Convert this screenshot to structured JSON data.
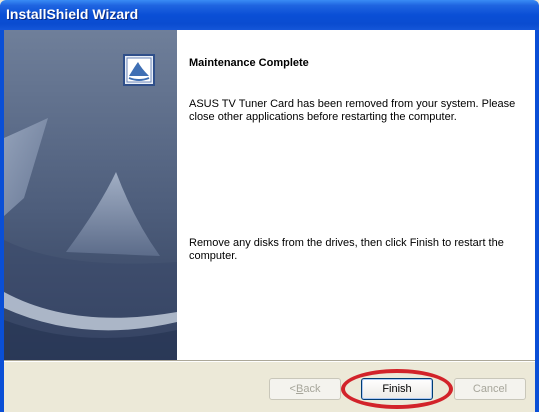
{
  "window": {
    "title": "InstallShield Wizard"
  },
  "main": {
    "heading": "Maintenance Complete",
    "message1": "ASUS TV Tuner Card has been removed from your system. Please close other applications before restarting the computer.",
    "message2": "Remove any disks from the drives, then click Finish to restart the computer."
  },
  "buttons": {
    "back_prefix": "< ",
    "back_mnemonic": "B",
    "back_rest": "ack",
    "finish": "Finish",
    "cancel": "Cancel"
  },
  "colors": {
    "titlebar": "#0a4fd6",
    "highlight": "#d2232a"
  },
  "icons": [
    "setup-wizard-icon",
    "sailboat-artwork"
  ]
}
